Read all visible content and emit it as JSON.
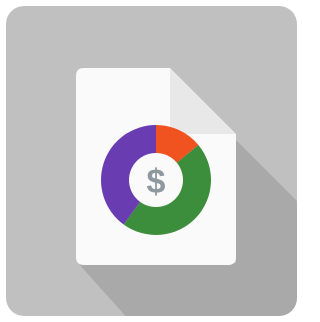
{
  "icon": {
    "name": "finance-report-document-icon",
    "symbol": "$",
    "colors": {
      "tile_background": "#c0c0c0",
      "long_shadow": "#a9a9a9",
      "page": "#fafafa",
      "page_fold": "#e8e8e8",
      "ring_purple": "#6a3cb2",
      "ring_green": "#3d8e3c",
      "ring_orange": "#f0531f",
      "center_circle": "#fafafa",
      "dollar_sign": "#8e999f"
    },
    "donut_segments": [
      {
        "name": "orange",
        "share": 0.14
      },
      {
        "name": "green",
        "share": 0.46
      },
      {
        "name": "purple",
        "share": 0.4
      }
    ]
  }
}
